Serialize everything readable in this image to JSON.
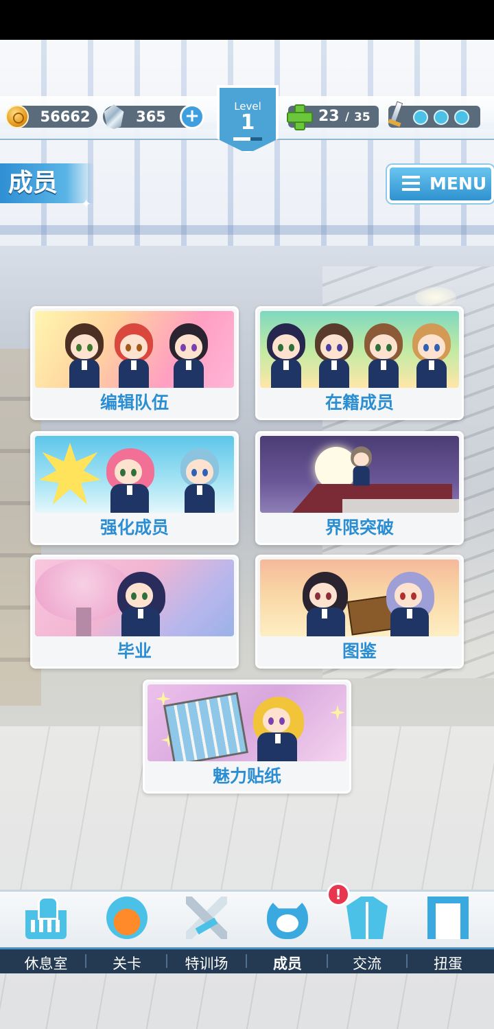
{
  "resources": {
    "coins": "56662",
    "gems": "365",
    "level_label": "Level",
    "level": "1",
    "level_progress": 0.6,
    "stamina_current": "23",
    "stamina_separator": "/",
    "stamina_max": "35",
    "sword_charges": 3
  },
  "header": {
    "title": "成员",
    "menu_label": "MENU"
  },
  "cards": [
    {
      "label": "编辑队伍"
    },
    {
      "label": "在籍成员"
    },
    {
      "label": "强化成员"
    },
    {
      "label": "界限突破"
    },
    {
      "label": "毕业"
    },
    {
      "label": "图鉴"
    },
    {
      "label": "魅力贴纸"
    }
  ],
  "nav": {
    "items": [
      {
        "label": "休息室",
        "icon": "school-icon"
      },
      {
        "label": "关卡",
        "icon": "stage-icon"
      },
      {
        "label": "特训场",
        "icon": "crossed-swords-icon"
      },
      {
        "label": "成员",
        "icon": "member-icon",
        "active": true
      },
      {
        "label": "交流",
        "icon": "uniform-icon"
      },
      {
        "label": "扭蛋",
        "icon": "curtain-icon"
      }
    ],
    "notification_badge": "!"
  },
  "colors": {
    "accent": "#2b8ed3",
    "nav_bg": "#243a52",
    "badge": "#e8364f"
  }
}
